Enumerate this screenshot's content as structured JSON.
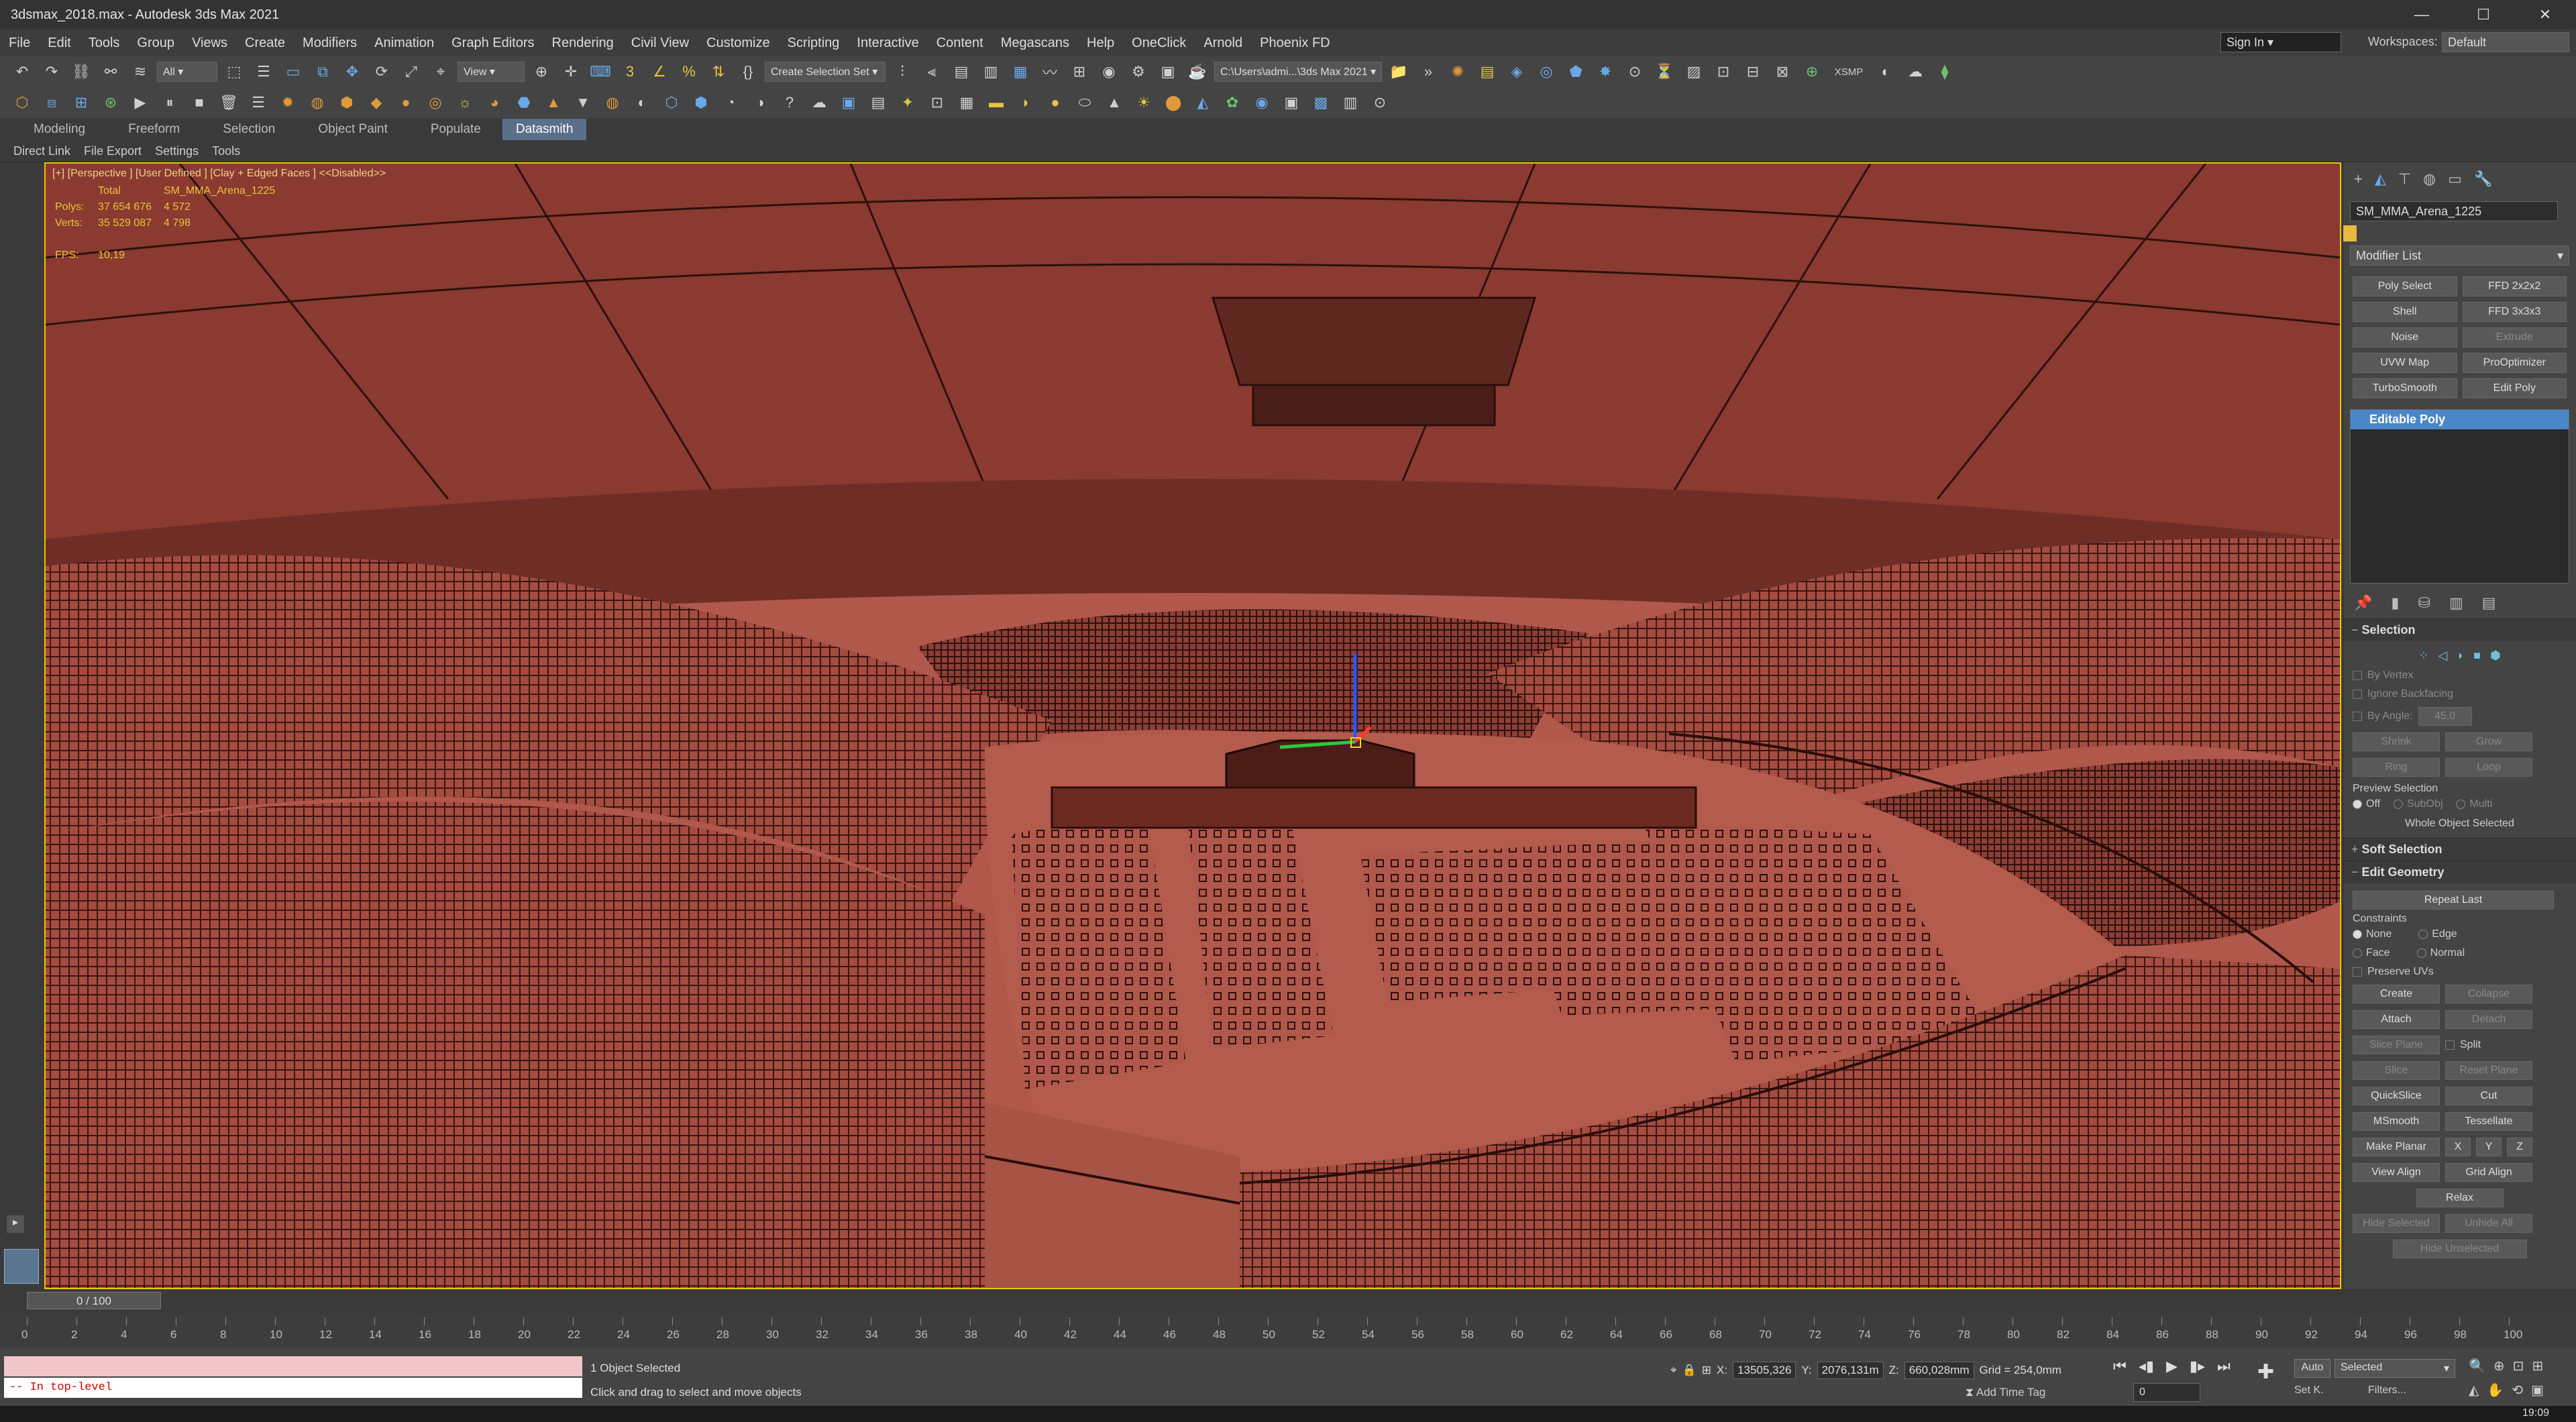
{
  "window": {
    "title": "3dsmax_2018.max - Autodesk 3ds Max 2021",
    "controls": [
      "—",
      "☐",
      "✕"
    ]
  },
  "menu": [
    "File",
    "Edit",
    "Tools",
    "Group",
    "Views",
    "Create",
    "Modifiers",
    "Animation",
    "Graph Editors",
    "Rendering",
    "Civil View",
    "Customize",
    "Scripting",
    "Interactive",
    "Content",
    "Megascans",
    "Help",
    "OneClick",
    "Arnold",
    "Phoenix FD"
  ],
  "account": {
    "signin": "Sign In",
    "workspace_label": "Workspaces:",
    "workspace_value": "Default"
  },
  "toolbar": {
    "filter_all": "All",
    "ref_coord": "View",
    "selection_set": "Create Selection Set",
    "path": "C:\\Users\\admi...\\3ds Max 2021",
    "xsmp": "XSMP"
  },
  "ribbon_tabs": [
    "Modeling",
    "Freeform",
    "Selection",
    "Object Paint",
    "Populate",
    "Datasmith"
  ],
  "ribbon_active": "Datasmith",
  "substrip": [
    "Direct Link",
    "File Export",
    "Settings",
    "Tools"
  ],
  "viewport": {
    "label": "[+] [Perspective ] [User Defined ] [Clay + Edged Faces ]  <<Disabled>>",
    "stats": {
      "total_label": "Total",
      "object_name": "SM_MMA_Arena_1225",
      "polys_label": "Polys:",
      "polys_total": "37 654 676",
      "polys_sel": "4 572",
      "verts_label": "Verts:",
      "verts_total": "35 529 087",
      "verts_sel": "4 798",
      "fps_label": "FPS:",
      "fps": "10,19"
    }
  },
  "command_panel": {
    "object_name": "SM_MMA_Arena_1225",
    "object_color": "#e8b940",
    "modifier_list": "Modifier List",
    "modifier_buttons": [
      {
        "label": "Poly Select",
        "dim": false
      },
      {
        "label": "FFD 2x2x2",
        "dim": false
      },
      {
        "label": "Shell",
        "dim": false
      },
      {
        "label": "FFD 3x3x3",
        "dim": false
      },
      {
        "label": "Noise",
        "dim": false
      },
      {
        "label": "Extrude",
        "dim": true
      },
      {
        "label": "UVW Map",
        "dim": false
      },
      {
        "label": "ProOptimizer",
        "dim": false
      },
      {
        "label": "TurboSmooth",
        "dim": false
      },
      {
        "label": "Edit Poly",
        "dim": false
      }
    ],
    "stack_selected": "Editable Poly",
    "selection": {
      "title": "Selection",
      "by_vertex": "By Vertex",
      "ignore_backfacing": "Ignore Backfacing",
      "by_angle": "By Angle:",
      "by_angle_value": "45,0",
      "shrink": "Shrink",
      "grow": "Grow",
      "ring": "Ring",
      "loop": "Loop",
      "preview_selection": "Preview Selection",
      "preview_off": "Off",
      "preview_subobj": "SubObj",
      "preview_multi": "Multi",
      "whole_object": "Whole Object Selected"
    },
    "soft_selection": "Soft Selection",
    "edit_geometry": {
      "title": "Edit Geometry",
      "repeat_last": "Repeat Last",
      "constraints": "Constraints",
      "c_none": "None",
      "c_edge": "Edge",
      "c_face": "Face",
      "c_normal": "Normal",
      "preserve_uvs": "Preserve UVs",
      "create": "Create",
      "collapse": "Collapse",
      "attach": "Attach",
      "detach": "Detach",
      "slice_plane": "Slice Plane",
      "split": "Split",
      "slice": "Slice",
      "reset_plane": "Reset Plane",
      "quickslice": "QuickSlice",
      "cut": "Cut",
      "msmooth": "MSmooth",
      "tessellate": "Tessellate",
      "make_planar": "Make Planar",
      "x": "X",
      "y": "Y",
      "z": "Z",
      "view_align": "View Align",
      "grid_align": "Grid Align",
      "relax": "Relax",
      "hide_selected": "Hide Selected",
      "unhide_all": "Unhide All",
      "hide_unselected": "Hide Unselected"
    }
  },
  "timeline": {
    "slider_label": "0 / 100",
    "ticks": [
      "0",
      "2",
      "4",
      "6",
      "8",
      "10",
      "12",
      "14",
      "16",
      "18",
      "20",
      "22",
      "24",
      "26",
      "28",
      "30",
      "32",
      "34",
      "36",
      "38",
      "40",
      "42",
      "44",
      "46",
      "48",
      "50",
      "52",
      "54",
      "56",
      "58",
      "60",
      "62",
      "64",
      "66",
      "68",
      "70",
      "72",
      "74",
      "76",
      "78",
      "80",
      "82",
      "84",
      "86",
      "88",
      "90",
      "92",
      "94",
      "96",
      "98",
      "100"
    ]
  },
  "status": {
    "script_text": "-- In top-level",
    "selected_count": "1 Object Selected",
    "prompt": "Click and drag to select and move objects",
    "x_label": "X:",
    "x_value": "13505,326",
    "y_label": "Y:",
    "y_value": "2076,131m",
    "z_label": "Z:",
    "z_value": "660,028mm",
    "grid": "Grid = 254,0mm",
    "add_time_tag": "Add Time Tag",
    "auto": "Auto",
    "selected_combo": "Selected",
    "set_k": "Set K.",
    "filters": "Filters...",
    "frame": "0"
  },
  "taskbar": {
    "clock": "19:09"
  }
}
